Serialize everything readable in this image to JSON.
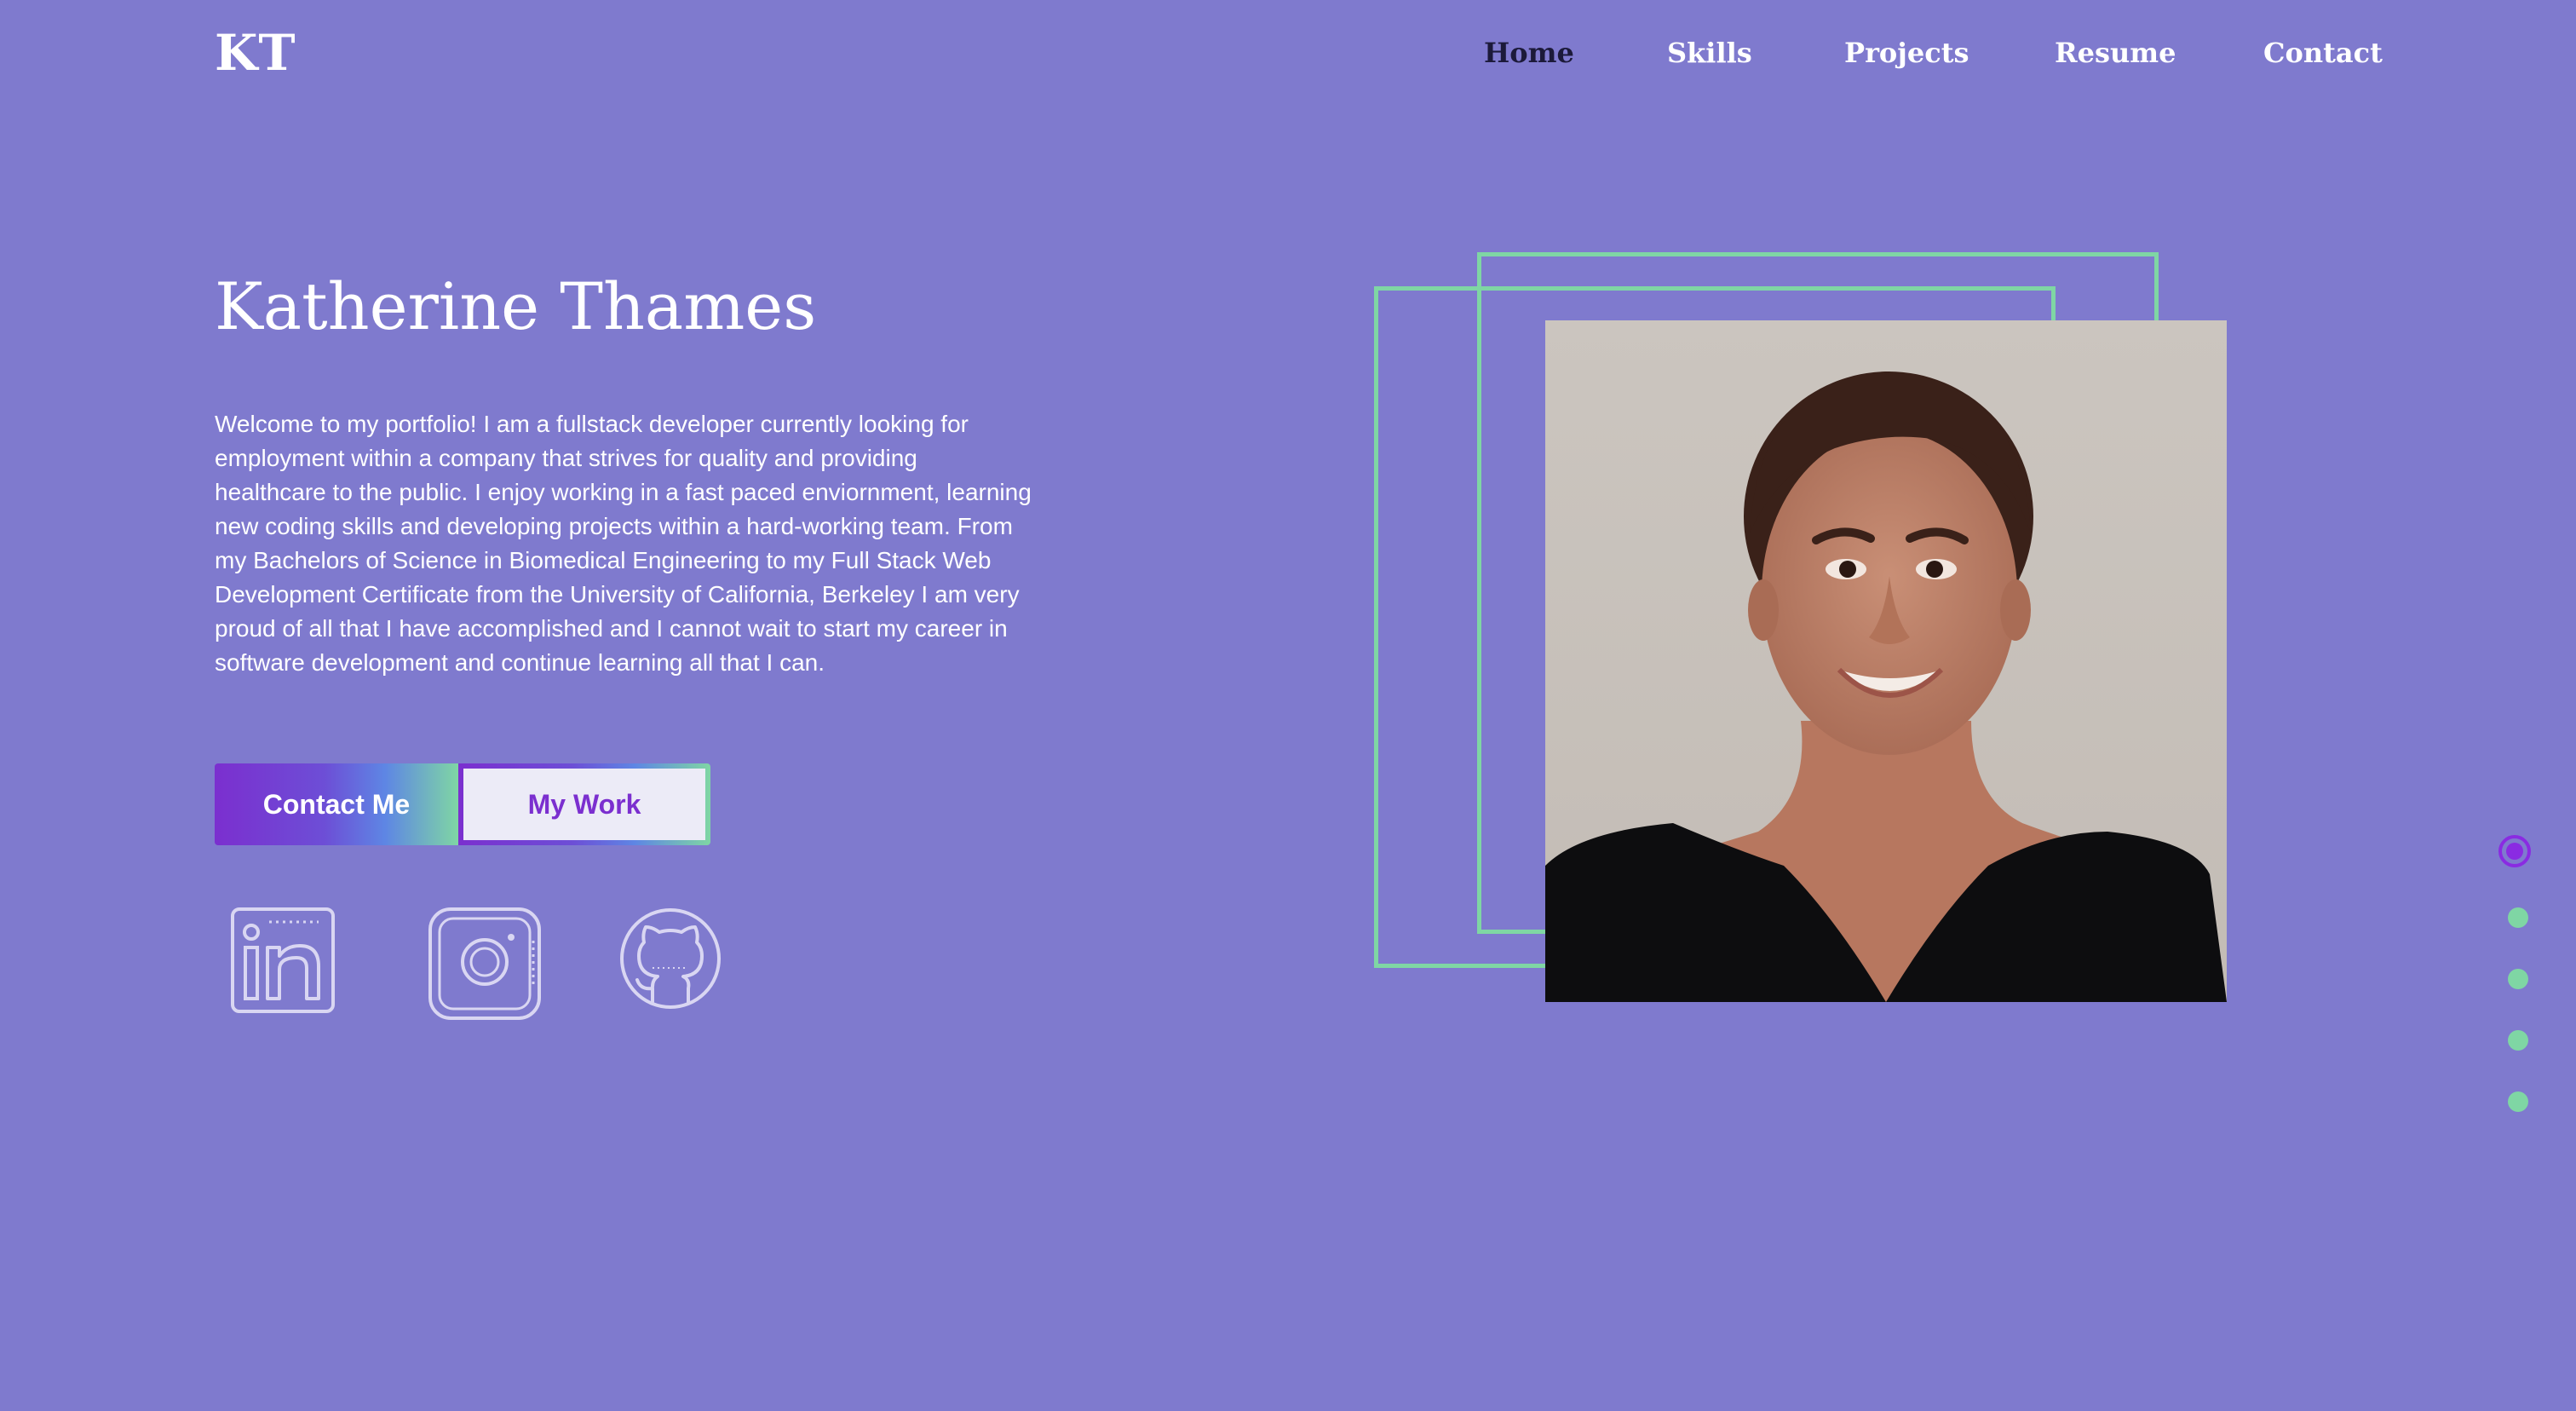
{
  "header": {
    "logo": "KT",
    "nav": [
      {
        "label": "Home",
        "active": true
      },
      {
        "label": "Skills",
        "active": false
      },
      {
        "label": "Projects",
        "active": false
      },
      {
        "label": "Resume",
        "active": false
      },
      {
        "label": "Contact",
        "active": false
      }
    ]
  },
  "hero": {
    "name": "Katherine Thames",
    "intro": "Welcome to my portfolio! I am a fullstack developer currently looking for employment within a company that strives for quality and providing healthcare to the public. I enjoy working in a fast paced enviornment, learning new coding skills and developing projects within a hard-working team. From my Bachelors of Science in Biomedical Engineering to my Full Stack Web Development Certificate from the University of California, Berkeley I am very proud of all that I have accomplished and I cannot wait to start my career in software development and continue learning all that I can.",
    "contact_button": "Contact Me",
    "work_button": "My Work"
  },
  "social": [
    {
      "icon": "linkedin-icon"
    },
    {
      "icon": "instagram-icon"
    },
    {
      "icon": "github-icon"
    }
  ],
  "section_nav": {
    "count": 5,
    "active_index": 0
  },
  "colors": {
    "background": "#7f7ace",
    "accent_green": "#7fd6a4",
    "accent_purple": "#7b2fcf",
    "active_nav": "#1c1a3a"
  }
}
